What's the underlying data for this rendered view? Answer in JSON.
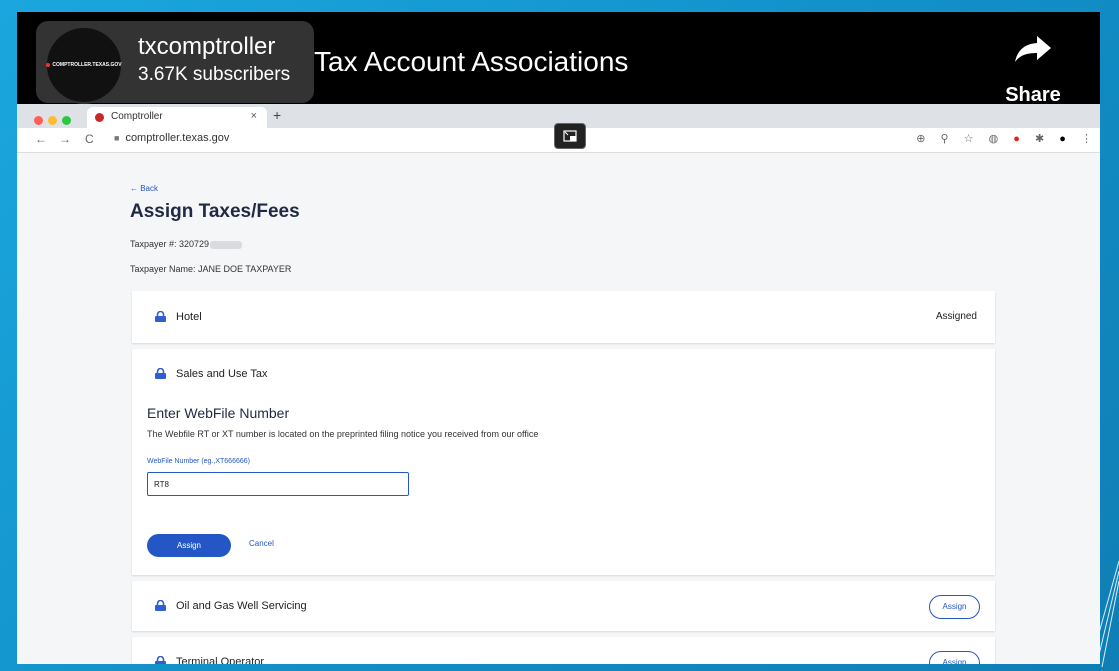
{
  "video": {
    "channel_name": "txcomptroller",
    "subscribers": "3.67K subscribers",
    "channel_logo_text": "COMPTROLLER.TEXAS.GOV",
    "title": "Tax Account Associations",
    "share_label": "Share"
  },
  "browser": {
    "tab_title": "Comptroller",
    "tab_close": "×",
    "new_tab": "+",
    "url": "comptroller.texas.gov",
    "nav": {
      "back": "←",
      "forward": "→",
      "reload": "C"
    },
    "toolbar_icons": [
      "⊕",
      "⚲",
      "☆",
      "◍",
      "●",
      "✱",
      "●",
      "⋮"
    ]
  },
  "page": {
    "back_link": "← Back",
    "title": "Assign Taxes/Fees",
    "taxpayer_number_label": "Taxpayer #: 320729",
    "taxpayer_name": "Taxpayer Name: JANE DOE TAXPAYER"
  },
  "sections": {
    "hotel": {
      "label": "Hotel",
      "status": "Assigned"
    },
    "sales": {
      "label": "Sales and Use Tax",
      "form_title": "Enter WebFile Number",
      "form_desc": "The Webfile RT or XT number is located on the preprinted filing notice you received from our office",
      "field_label": "WebFile Number (eg.,XT666666)",
      "field_value": "RT8",
      "assign_button": "Assign",
      "cancel_button": "Cancel"
    },
    "oil_gas": {
      "label": "Oil and Gas Well Servicing",
      "button": "Assign"
    },
    "terminal": {
      "label": "Terminal Operator",
      "button": "Assign"
    }
  },
  "colors": {
    "accent": "#2457c5",
    "lock": "#2f5fd0",
    "background_frame": "#1aa7de"
  }
}
